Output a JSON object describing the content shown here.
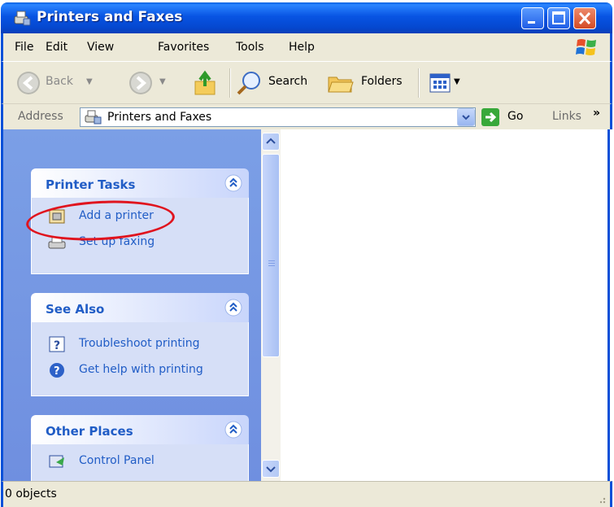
{
  "window": {
    "title": "Printers and Faxes",
    "app_icon": "printer-fax-icon"
  },
  "menu": [
    "File",
    "Edit",
    "View",
    "Favorites",
    "Tools",
    "Help"
  ],
  "toolbar": {
    "back_label": "Back",
    "search_label": "Search",
    "folders_label": "Folders"
  },
  "address": {
    "label": "Address",
    "value": "Printers and Faxes",
    "go_label": "Go",
    "links_label": "Links"
  },
  "panels": {
    "printer_tasks": {
      "title": "Printer Tasks",
      "items": [
        "Add a printer",
        "Set up faxing"
      ]
    },
    "see_also": {
      "title": "See Also",
      "items": [
        "Troubleshoot printing",
        "Get help with printing"
      ]
    },
    "other_places": {
      "title": "Other Places",
      "items": [
        "Control Panel"
      ]
    }
  },
  "status": {
    "text": "0 objects"
  },
  "colors": {
    "title_blue": "#0854e3",
    "link_blue": "#215dc6",
    "annotation_red": "#e0141e"
  }
}
